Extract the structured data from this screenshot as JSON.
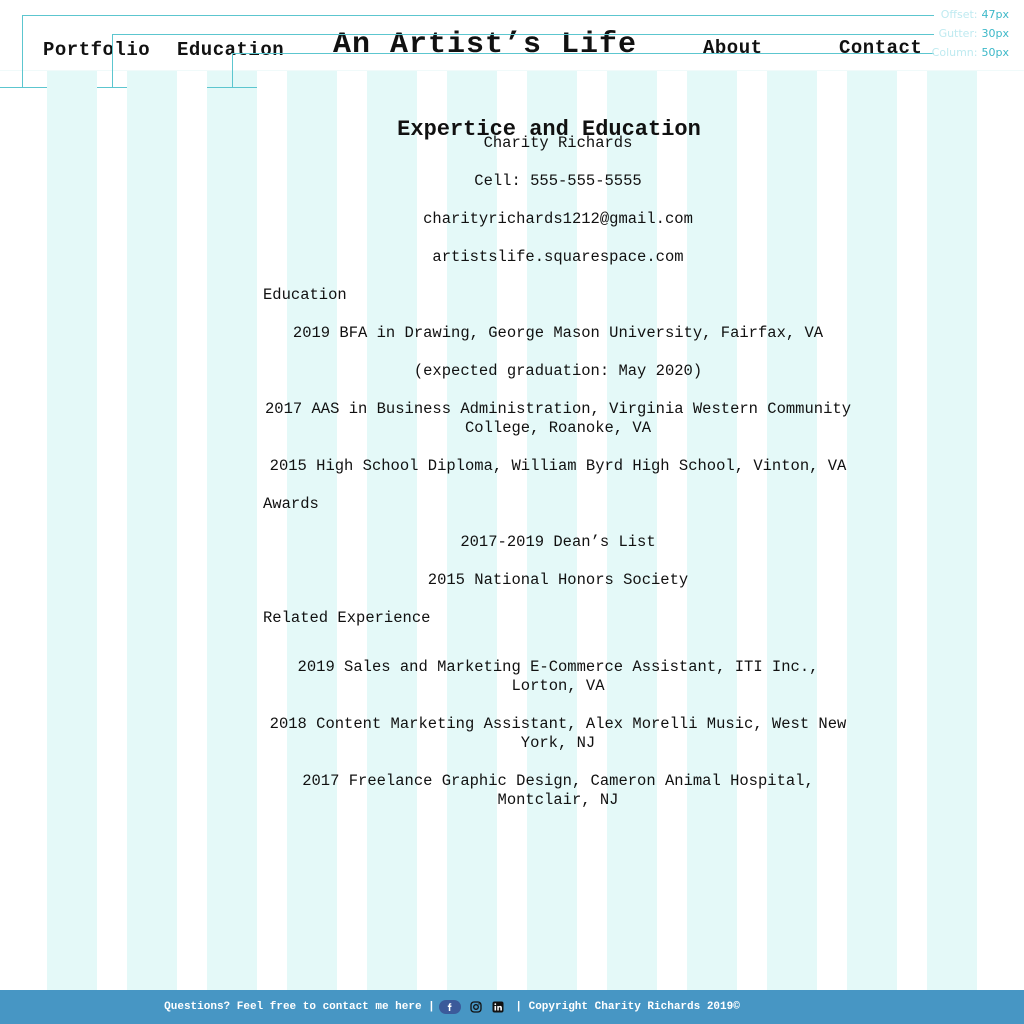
{
  "header": {
    "nav_left": [
      "Portfolio",
      "Education"
    ],
    "site_title": "An Artist’s Life",
    "nav_right": [
      "About",
      "Contact"
    ]
  },
  "grid_legend": {
    "offset_label": "Offset:",
    "offset_value": "47px",
    "gutter_label": "Gutter:",
    "gutter_value": "30px",
    "column_label": "Column:",
    "column_value": "50px"
  },
  "main": {
    "heading": "Expertice and Education",
    "contact": {
      "name": "Charity Richards",
      "cell": "Cell: 555-555-5555",
      "email": "charityrichards1212@gmail.com",
      "website": "artistslife.squarespace.com"
    },
    "education_heading": "Education",
    "education": [
      "2019 BFA in Drawing, George Mason University, Fairfax, VA",
      "(expected graduation: May 2020)",
      "2017 AAS in Business Administration, Virginia Western Community College, Roanoke, VA",
      "2015 High School Diploma, William Byrd High School, Vinton, VA"
    ],
    "awards_heading": "Awards",
    "awards": [
      "2017-2019 Dean’s List",
      "2015 National Honors Society"
    ],
    "experience_heading": "Related Experience",
    "experience": [
      "2019 Sales and Marketing E-Commerce Assistant, ITI Inc., Lorton, VA",
      "2018 Content Marketing Assistant, Alex Morelli Music, West New York, NJ",
      "2017 Freelance Graphic Design, Cameron Animal Hospital, Montclair, NJ"
    ]
  },
  "footer": {
    "contact_text": "Questions? Feel free to contact me here |",
    "copyright_text": " | Copyright Charity Richards 2019©",
    "icons": [
      "facebook-icon",
      "instagram-icon",
      "linkedin-icon"
    ]
  },
  "colors": {
    "grid_column": "#e4f9f8",
    "guide_line": "#5cc6cf",
    "footer_bg": "#4796c4"
  }
}
